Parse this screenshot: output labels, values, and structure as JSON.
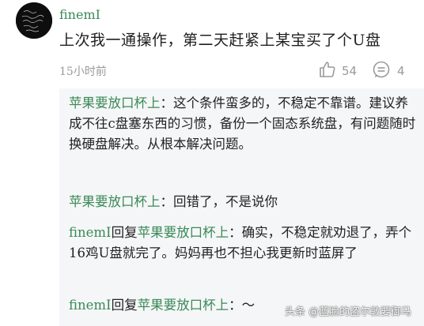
{
  "comment": {
    "username": "finemI",
    "text": "上次我一通操作，第二天赶紧上某宝买了个U盘",
    "time": "15小时前",
    "like_icon": "thumbs-up-icon",
    "like_count": "54",
    "reply_icon": "comment-bubble-icon",
    "reply_count": "4"
  },
  "replies": [
    {
      "author": "苹果要放口杯上",
      "reply_to": "",
      "sep": "：",
      "text": "这个条件蛮多的，不稳定不靠谱。建议养成不往c盘塞东西的习惯，备份一个固态系统盘，有问题随时换硬盘解决。从根本解决问题。"
    },
    {
      "author": "苹果要放口杯上",
      "reply_to": "",
      "sep": "：",
      "text": "回错了，不是说你"
    },
    {
      "author": "finemI",
      "reply_word": "回复",
      "reply_to": "苹果要放口杯上",
      "sep": "：",
      "text": "确实，不稳定就劝退了，弄个16鸡U盘就完了。妈妈再也不担心我更新时蓝屏了"
    },
    {
      "author": "finemI",
      "reply_word": "回复",
      "reply_to": "苹果要放口杯上",
      "sep": "：",
      "text": "〜"
    }
  ],
  "watermark": "头条 @蓝脸的盗尔敦要御马",
  "colors": {
    "accent_green": "#3a8a58",
    "reply_bg": "#f5f6f7",
    "muted": "#9a9a9a"
  }
}
